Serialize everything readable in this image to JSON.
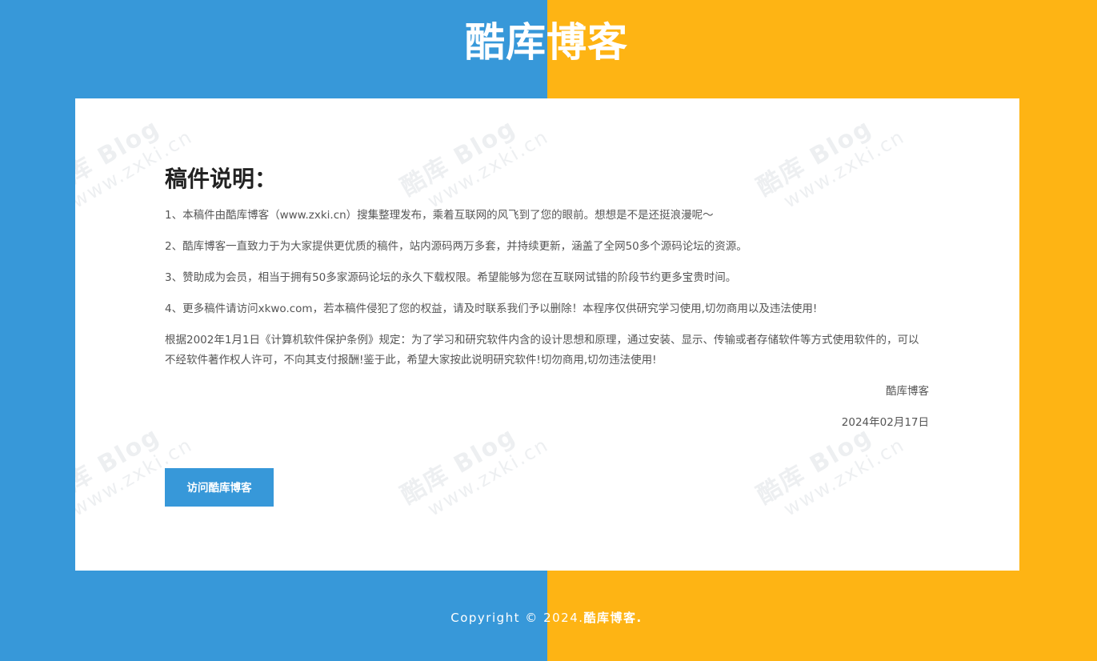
{
  "colors": {
    "left_background": "#3798d9",
    "right_background": "#feb414",
    "card_background": "#ffffff",
    "button_background": "#3798d9"
  },
  "header": {
    "title": "酷库博客"
  },
  "watermark": {
    "main": "酷库 Blog",
    "url": "www.zxki.cn"
  },
  "notice": {
    "heading": "稿件说明：",
    "paragraphs": [
      "1、本稿件由酷库博客（www.zxki.cn）搜集整理发布，乘着互联网的风飞到了您的眼前。想想是不是还挺浪漫呢～",
      "2、酷库博客一直致力于为大家提供更优质的稿件，站内源码两万多套，并持续更新，涵盖了全网50多个源码论坛的资源。",
      "3、赞助成为会员，相当于拥有50多家源码论坛的永久下载权限。希望能够为您在互联网试错的阶段节约更多宝贵时间。",
      "4、更多稿件请访问xkwo.com，若本稿件侵犯了您的权益，请及时联系我们予以删除！本程序仅供研究学习使用,切勿商用以及违法使用!",
      "根据2002年1月1日《计算机软件保护条例》规定：为了学习和研究软件内含的设计思想和原理，通过安装、显示、传输或者存储软件等方式使用软件的，可以不经软件著作权人许可，不向其支付报酬!鉴于此，希望大家按此说明研究软件!切勿商用,切勿违法使用!"
    ],
    "signature": "酷库博客",
    "date": "2024年02月17日",
    "visit_button_label": "访问酷库博客"
  },
  "footer": {
    "copyright_prefix": "Copyright © 2024.",
    "copyright_brand": "酷库博客."
  }
}
